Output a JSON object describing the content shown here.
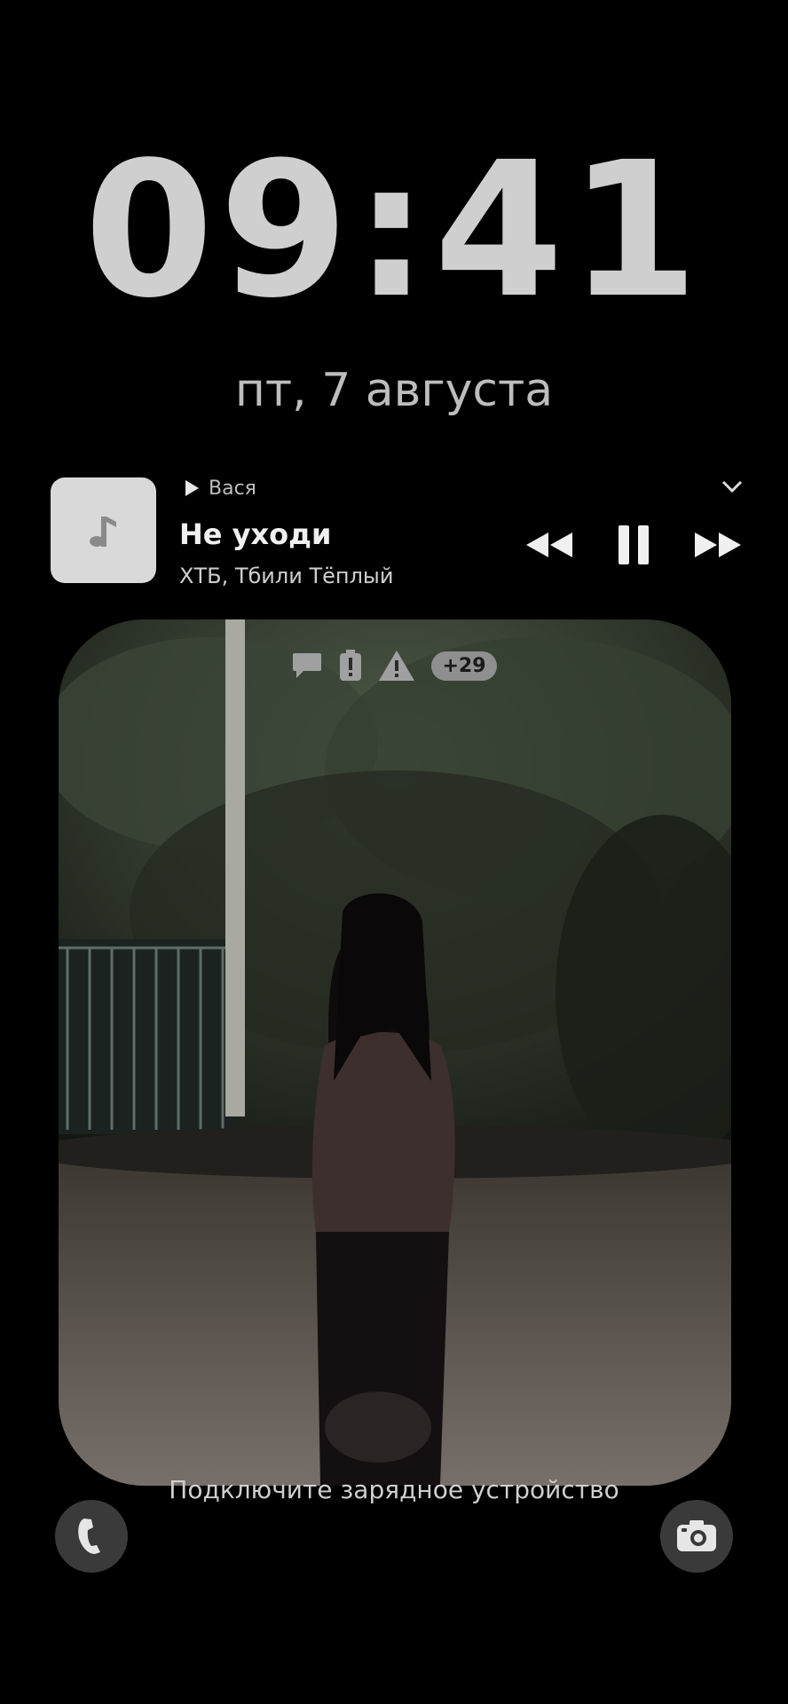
{
  "lockscreen": {
    "time": "09:41",
    "date": "пт, 7 августа",
    "charging_hint": "Подключите зарядное устройство"
  },
  "media": {
    "source_app": "Вася",
    "title": "Не уходи",
    "artist": "ХТБ, Тбили Тёплый"
  },
  "notifications": {
    "icons": [
      "chat-bubble-icon",
      "battery-alert-icon",
      "warning-icon"
    ],
    "overflow_count": "+29"
  },
  "shortcuts": {
    "left": "phone-icon",
    "right": "camera-icon"
  }
}
